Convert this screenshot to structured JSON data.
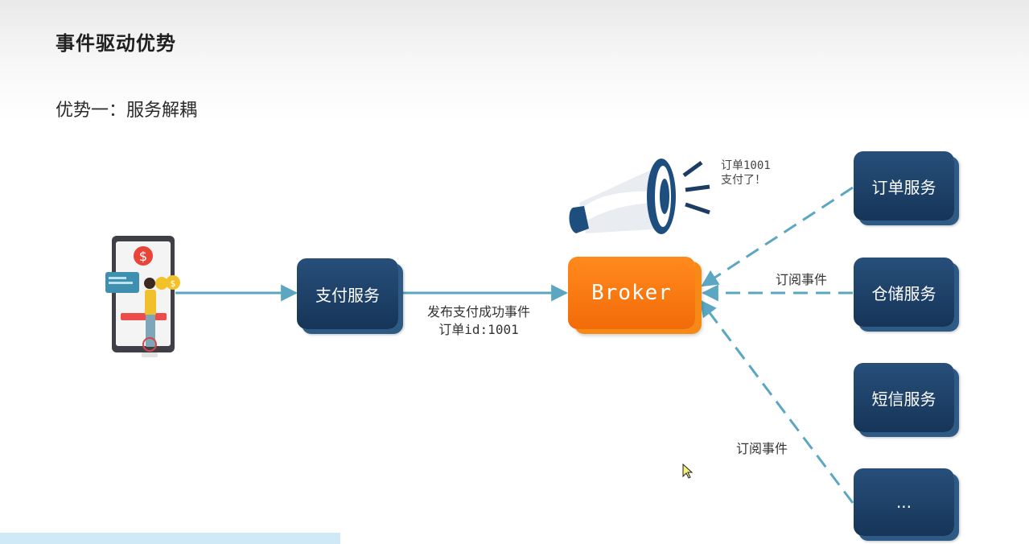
{
  "title": "事件驱动优势",
  "subtitle": "优势一：服务解耦",
  "nodes": {
    "payment_service": "支付服务",
    "broker": "Broker",
    "order_service": "订单服务",
    "warehouse_service": "仓储服务",
    "sms_service": "短信服务",
    "more_service": "..."
  },
  "labels": {
    "publish_line1": "发布支付成功事件",
    "publish_line2": "订单id:1001",
    "announce_line1": "订单1001",
    "announce_line2": "支付了！",
    "subscribe_1": "订阅事件",
    "subscribe_2": "订阅事件"
  },
  "colors": {
    "service_box": "#1d4066",
    "broker": "#f97a10",
    "arrow": "#5ba7c3"
  },
  "icons": [
    "phone-payment-illustration",
    "megaphone-icon"
  ]
}
